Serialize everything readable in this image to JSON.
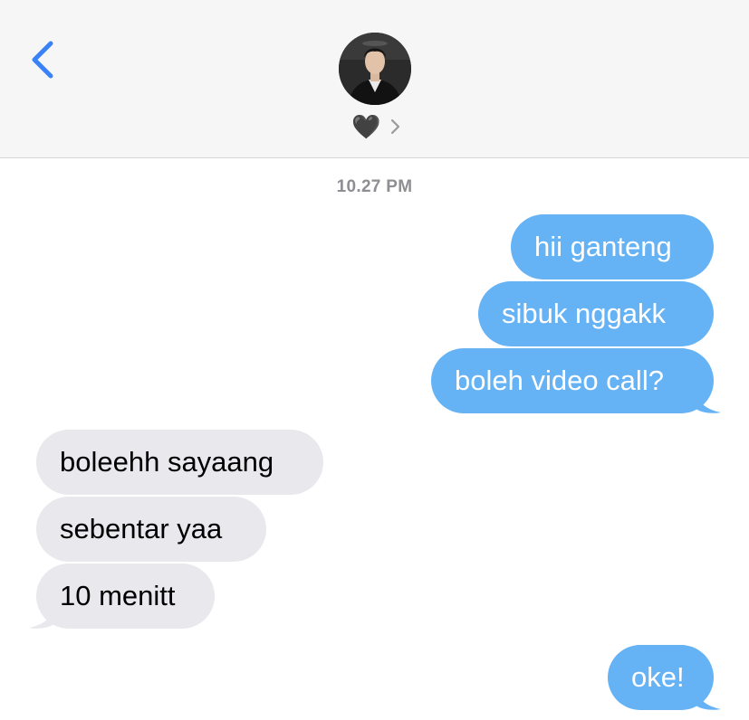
{
  "header": {
    "back_icon": "chevron-left-icon",
    "contact_name": "🖤",
    "contact_chevron_icon": "chevron-right-icon",
    "accent_color": "#3a82f7"
  },
  "conversation": {
    "timestamp": "10.27 PM",
    "outgoing_color": "#65b2f5",
    "incoming_color": "#e8e8ed",
    "messages": [
      {
        "from": "me",
        "text": "hii ganteng"
      },
      {
        "from": "me",
        "text": "sibuk nggakk"
      },
      {
        "from": "me",
        "text": "boleh video call?"
      },
      {
        "from": "them",
        "text": "boleehh sayaang"
      },
      {
        "from": "them",
        "text": "sebentar yaa"
      },
      {
        "from": "them",
        "text": "10 menitt"
      },
      {
        "from": "me",
        "text": "oke!"
      }
    ]
  }
}
